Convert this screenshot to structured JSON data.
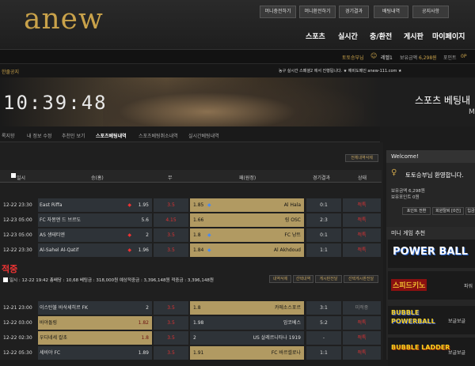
{
  "header": {
    "logo": "anew",
    "top_buttons": [
      "머니충전하기",
      "머니환전하기",
      "경기결과",
      "배팅내역",
      "공지사항"
    ],
    "nav": [
      "스포츠",
      "실시간",
      "충/환전",
      "게시판",
      "마이페이지"
    ]
  },
  "infobar": {
    "user": "토토승부님",
    "level": "레벨1",
    "balance_label": "보유금액",
    "balance": "6,298원",
    "point_label": "포인트",
    "point": "0P"
  },
  "notice": {
    "label": "한줄공지",
    "text": "농구 실시간 스페셜2 에서 진행됩니다. ★ 예비도메인 anew-111.com ★"
  },
  "banner": {
    "clock": "10:39:48",
    "title": "스포츠 베팅내",
    "sub": "M"
  },
  "subnav": [
    "록지향",
    "내 정보 수정",
    "추천인 보기",
    "스포츠베팅내역",
    "스포츠베팅취소내역",
    "실시간베팅내역"
  ],
  "table": {
    "history_btn": "전체내역삭제",
    "headers": [
      "일시",
      "승(홈)",
      "무",
      "패(원정)",
      "경기결과",
      "상태"
    ],
    "rows": [
      {
        "date": "12-22 23:30",
        "home": "East Riffa",
        "home_odd": "1.95",
        "draw": "3.5",
        "away_odd": "1.85",
        "away": "Al Hala",
        "score": "0:1",
        "state": "적특",
        "home_mark": "red",
        "away_mark": "blue",
        "hl": "away"
      },
      {
        "date": "12-23 05:00",
        "home": "FC 자몽앤 드 브르도",
        "home_odd": "5.6",
        "draw": "4.15",
        "away_odd": "1.66",
        "away": "링 OSC",
        "score": "2:3",
        "state": "적특",
        "home_mark": "",
        "away_mark": "",
        "hl": "away"
      },
      {
        "date": "12-23 05:00",
        "home": "AS 생테티엔",
        "home_odd": "2",
        "draw": "3.5",
        "away_odd": "1.8",
        "away": "FC 낭트",
        "score": "0:1",
        "state": "적특",
        "home_mark": "red",
        "away_mark": "blue",
        "hl": "away"
      },
      {
        "date": "12-22 23:30",
        "home": "Al-Sahel Al-Qatif",
        "home_odd": "1.96",
        "draw": "3.5",
        "away_odd": "1.84",
        "away": "Al Akhdoud",
        "score": "1:1",
        "state": "적특",
        "home_mark": "red",
        "away_mark": "blue",
        "hl": "away"
      }
    ]
  },
  "betsummary": {
    "label": "적중",
    "info": "일시 : 12-22 19:42  총배당 : 10,68  베팅금 : 318,000원  예상적중금 : 3,396,148원  적중금 : 3,396,148원",
    "buttons": [
      "내역삭제",
      "선택내역",
      "게시판전달",
      "선택게시판전달"
    ]
  },
  "table2": {
    "rows": [
      {
        "date": "12-21 23:00",
        "home": "이스탄불 바삭셰히르 FK",
        "home_odd": "2",
        "draw": "3.5",
        "away_odd": "1.8",
        "away": "카에소스포르",
        "score": "3:1",
        "state": "미적중",
        "hl": "away"
      },
      {
        "date": "12-22 03:00",
        "home": "바야돌링",
        "home_odd": "1.82",
        "draw": "3.5",
        "away_odd": "1.98",
        "away": "암코베스",
        "score": "5:2",
        "state": "적특",
        "hl": "home"
      },
      {
        "date": "12-22 02:30",
        "home": "우디네세 칼초",
        "home_odd": "1.8",
        "draw": "3.5",
        "away_odd": "2",
        "away": "US 살레르니타나 1919",
        "score": "-",
        "state": "적특",
        "hl": "home"
      },
      {
        "date": "12-22 05:30",
        "home": "세비야 FC",
        "home_odd": "1.89",
        "draw": "3.5",
        "away_odd": "1.91",
        "away": "FC 바르셀로나",
        "score": "1:1",
        "state": "적특",
        "hl": "away"
      }
    ]
  },
  "right": {
    "welcome": "Welcome!",
    "greet": "토토승부님 환영합니다.",
    "balance_line": "보유금액 6,298원",
    "point_line": "보유포인트 0원",
    "btns": [
      "포인트 전환",
      "회원탈퇴 [0건]",
      "입금"
    ],
    "minigame": "미니 게임 추천",
    "games": [
      "POWER BALL",
      "스피드키노",
      "BUBBLE POWERBALL",
      "BUBBLE LADDER"
    ],
    "game_side": [
      "",
      "파워",
      "보글보글",
      "보글보글"
    ]
  },
  "colors": {
    "accent": "#c9a24a",
    "odd_red": "#e33",
    "odd_blue": "#4a8af0",
    "hl_gold": "#b19a62"
  }
}
